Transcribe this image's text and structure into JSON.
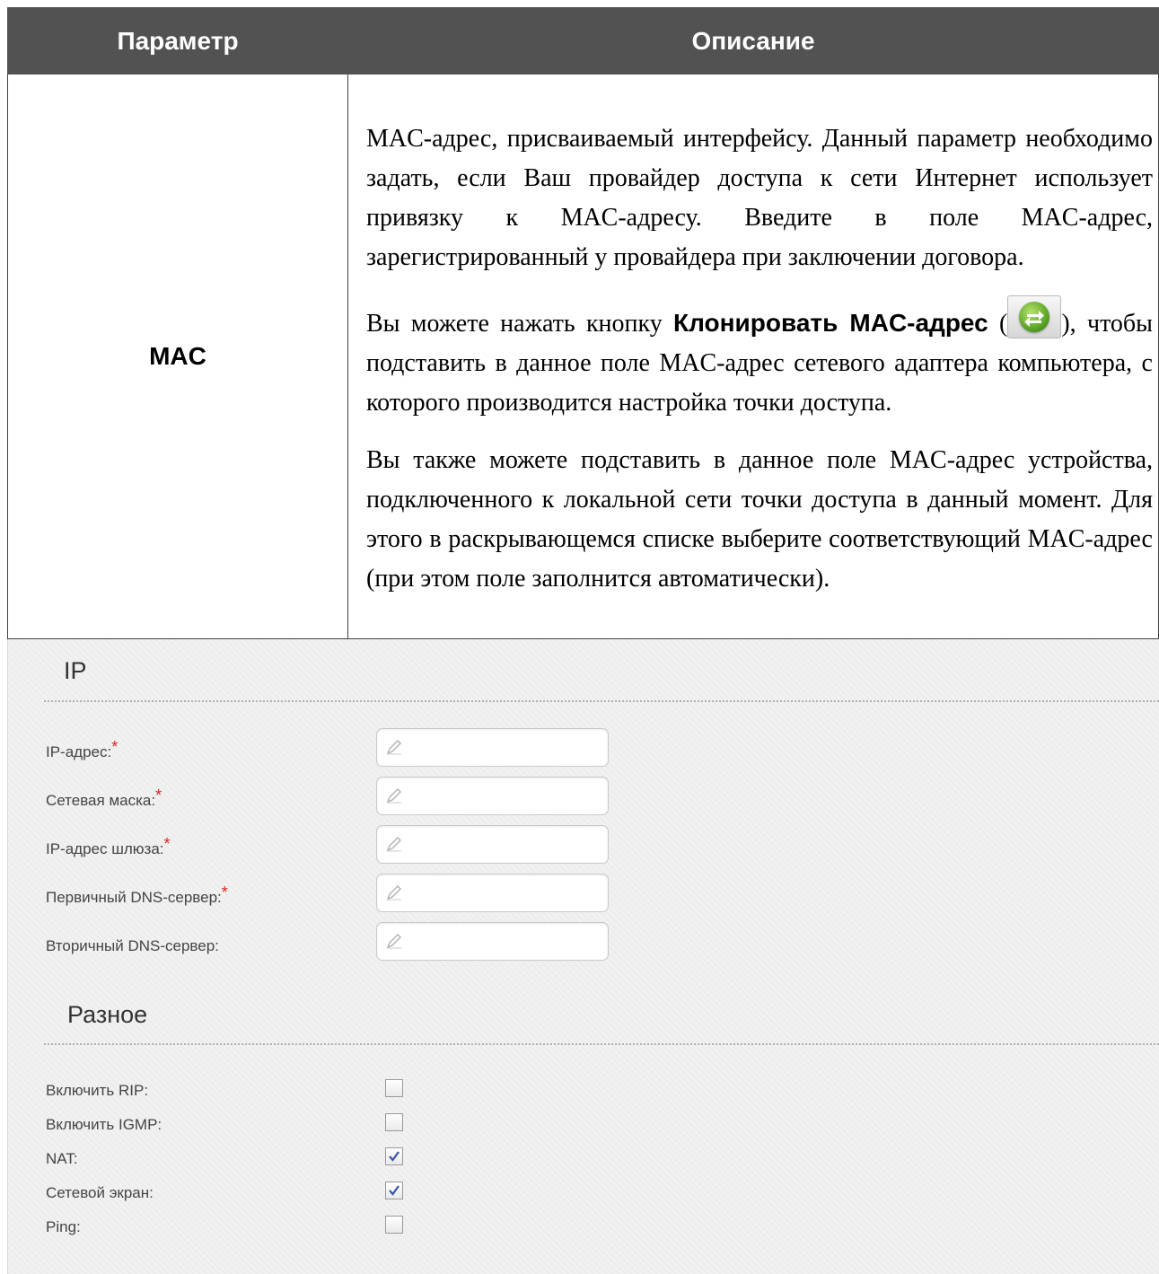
{
  "table": {
    "header_param": "Параметр",
    "header_desc": "Описание",
    "row_param": "MAC",
    "para1": "MAC-адрес, присваиваемый интерфейсу. Данный параметр необходимо задать, если Ваш провайдер доступа к сети Интернет использует привязку к MAC-адресу. Введите в поле MAC-адрес, зарегистрированный у провайдера при заключении договора.",
    "para2_before": "Вы можете нажать кнопку ",
    "para2_bold": "Клонировать MAC-адрес",
    "para2_open": " (",
    "para2_after": "), чтобы подставить в данное поле MAC-адрес сетевого адаптера компьютера, с которого производится настройка точки доступа.",
    "para3": "Вы также можете подставить в данное поле MAC-адрес устройства, подключенного к локальной сети точки доступа в данный момент. Для этого в раскрывающемся списке выберите соответствующий MAC-адрес (при этом поле заполнится автоматически).",
    "clone_icon": "clone-mac-icon"
  },
  "ip_section": {
    "title": "IP",
    "fields": [
      {
        "label": "IP-адрес:",
        "required": "*",
        "value": ""
      },
      {
        "label": "Сетевая маска:",
        "required": "*",
        "value": ""
      },
      {
        "label": "IP-адрес шлюза:",
        "required": "*",
        "value": ""
      },
      {
        "label": "Первичный DNS-сервер:",
        "required": "*",
        "value": ""
      },
      {
        "label": "Вторичный DNS-сервер:",
        "required": "",
        "value": ""
      }
    ],
    "field_icon": "pencil-icon"
  },
  "misc_section": {
    "title": "Разное",
    "checkboxes": [
      {
        "label": "Включить RIP:",
        "checked": false
      },
      {
        "label": "Включить IGMP:",
        "checked": false
      },
      {
        "label": "NAT:",
        "checked": true
      },
      {
        "label": "Сетевой экран:",
        "checked": true
      },
      {
        "label": "Ping:",
        "checked": false
      }
    ]
  },
  "colors": {
    "header_bg": "#525252",
    "panel_bg": "#f1f1f1",
    "required_mark": "#e02020",
    "check_mark": "#3a55a8"
  }
}
